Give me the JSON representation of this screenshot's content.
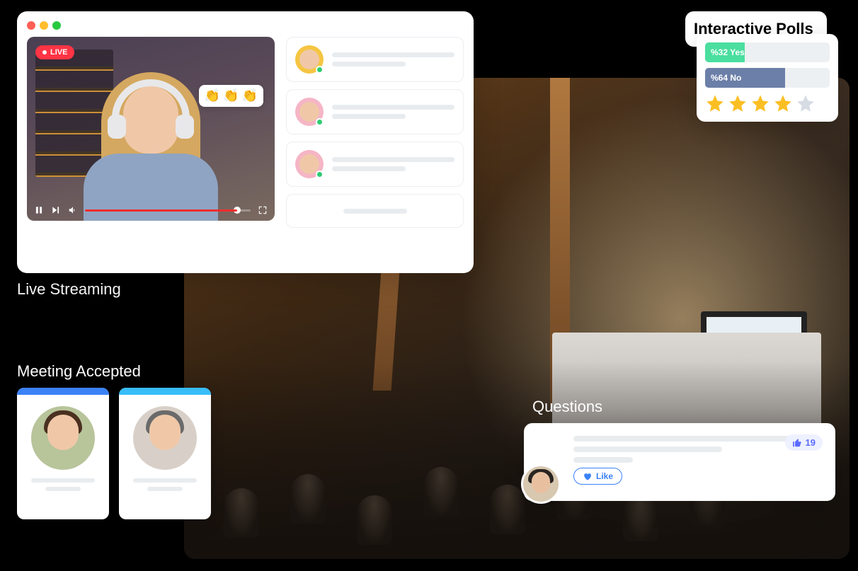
{
  "labels": {
    "streaming": "Live Streaming",
    "meeting": "Meeting Accepted",
    "polls": "Interactive Polls",
    "questions": "Questions"
  },
  "stream": {
    "live_badge": "LIVE",
    "reactions": [
      "👏",
      "👏",
      "👏"
    ],
    "participant_avatars": [
      {
        "bg": "#f5c542"
      },
      {
        "bg": "#f5b5c5"
      },
      {
        "bg": "#f5b5c5"
      }
    ]
  },
  "polls": {
    "options": [
      {
        "key": "yes",
        "label": "%32 Yes",
        "percent": 32,
        "color": "#4ade9f"
      },
      {
        "key": "no",
        "label": "%64 No",
        "percent": 64,
        "color": "#6b7fa8"
      }
    ],
    "rating": {
      "stars": 5,
      "filled": 4
    }
  },
  "meeting": {
    "cards": [
      {
        "bar": "blue",
        "hair": "#4a3020",
        "bg": "#b8c49a"
      },
      {
        "bar": "cyan",
        "hair": "#6a6a6a",
        "bg": "#d8d0c8"
      }
    ]
  },
  "questions": {
    "like_label": "Like",
    "like_count": "19"
  }
}
